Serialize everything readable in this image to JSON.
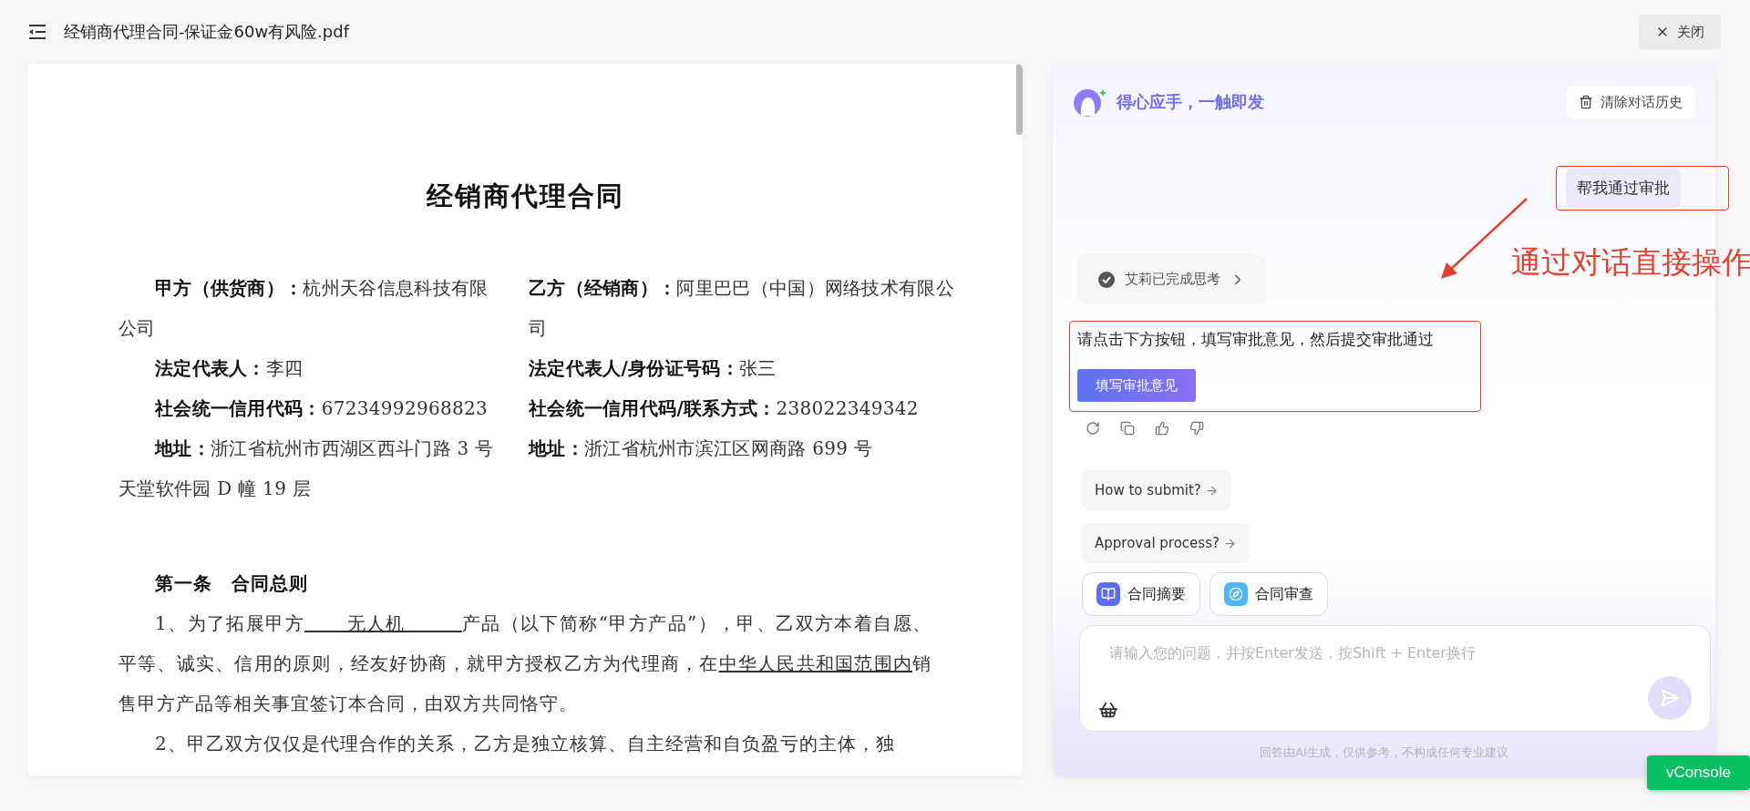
{
  "header": {
    "title": "经销商代理合同-保证金60w有风险.pdf",
    "close_button": "关闭"
  },
  "document": {
    "title": "经销商代理合同",
    "parties": [
      {
        "fields": [
          {
            "label": "甲方（供货商）：",
            "value": "杭州天谷信息科技有限公司"
          },
          {
            "label": "法定代表人：",
            "value": "李四"
          },
          {
            "label": "社会统一信用代码：",
            "value": "67234992968823"
          },
          {
            "label": "地址：",
            "value": "浙江省杭州市西湖区西斗门路 3 号天堂软件园 D 幢 19 层"
          }
        ]
      },
      {
        "fields": [
          {
            "label": "乙方（经销商）：",
            "value": "阿里巴巴（中国）网络技术有限公司"
          },
          {
            "label": "法定代表人/身份证号码：",
            "value": "张三"
          },
          {
            "label": "社会统一信用代码/联系方式：",
            "value": "238022349342"
          },
          {
            "label": "地址：",
            "value": "浙江省杭州市滨江区网商路 699 号"
          }
        ]
      }
    ],
    "section_heading": "第一条　合同总则",
    "paragraphs": [
      {
        "segments": [
          {
            "kind": "plain",
            "text": "1、为了拓展甲方"
          },
          {
            "kind": "blank",
            "text": "无人机"
          },
          {
            "kind": "plain",
            "text": "产品（以下简称“甲方产品”），甲、乙双方本着自愿、平等、诚实、信用的原则，经友好协商，就甲方授权乙方为代理商，在"
          },
          {
            "kind": "underline",
            "text": "中华人民共和国范围内"
          },
          {
            "kind": "plain",
            "text": "销售甲方产品等相关事宜签订本合同，由双方共同恪守。"
          }
        ]
      },
      {
        "segments": [
          {
            "kind": "plain",
            "text": "2、甲乙双方仅仅是代理合作的关系，乙方是独立核算、自主经营和自负盈亏的主体，独"
          }
        ]
      }
    ]
  },
  "assistant": {
    "brand": "得心应手，一触即发",
    "clear_button": "清除对话历史",
    "user_message": "帮我通过审批",
    "thinking": {
      "label": "艾莉已完成思考",
      "expanded": false
    },
    "reply": "请点击下方按钮，填写审批意见，然后提交审批通过",
    "reply_action": "填写审批意见",
    "suggestions": [
      "How to submit?",
      "Approval process?"
    ],
    "tools": [
      {
        "kind": "summary",
        "label": "合同摘要"
      },
      {
        "kind": "review",
        "label": "合同审查"
      }
    ],
    "input": {
      "placeholder": "请输入您的问题，并按Enter发送，按Shift + Enter换行"
    },
    "disclaimer": "回答由AI生成，仅供参考，不构成任何专业建议"
  },
  "annotation": "通过对话直接操作",
  "vconsole": "vConsole"
}
